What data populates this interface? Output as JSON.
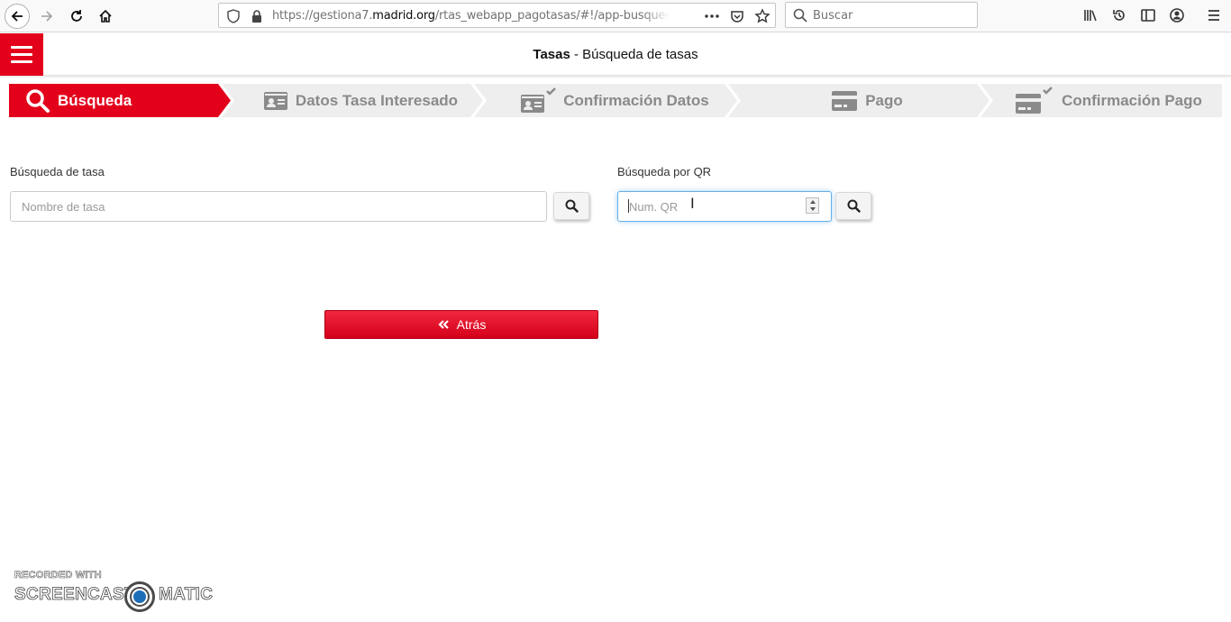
{
  "browser": {
    "url_prefix": "https://gestiona7.",
    "url_host": "madrid.org",
    "url_path": "/rtas_webapp_pagotasas/#!/app-busqueda-",
    "search_placeholder": "Buscar"
  },
  "header": {
    "title_bold": "Tasas",
    "title_rest": " - Búsqueda de tasas"
  },
  "stepper": {
    "steps": [
      {
        "label": "Búsqueda",
        "icon": "search-icon",
        "state": "active"
      },
      {
        "label": "Datos Tasa Interesado",
        "icon": "id-card-icon",
        "state": "pending"
      },
      {
        "label": "Confirmación Datos",
        "icon": "id-card-check-icon",
        "state": "pending"
      },
      {
        "label": "Pago",
        "icon": "credit-card-icon",
        "state": "pending"
      },
      {
        "label": "Confirmación Pago",
        "icon": "credit-card-check-icon",
        "state": "pending"
      }
    ],
    "active_color": "#e3001b",
    "inactive_color": "#eeeeee"
  },
  "form": {
    "tasa_label": "Búsqueda de tasa",
    "tasa_placeholder": "Nombre de tasa",
    "qr_label": "Búsqueda por QR",
    "qr_placeholder": "Num. QR"
  },
  "actions": {
    "back_label": "Atrás"
  },
  "watermark": {
    "line1": "RECORDED WITH",
    "line2_left": "SCREENCAST",
    "line2_right": "MATIC"
  }
}
